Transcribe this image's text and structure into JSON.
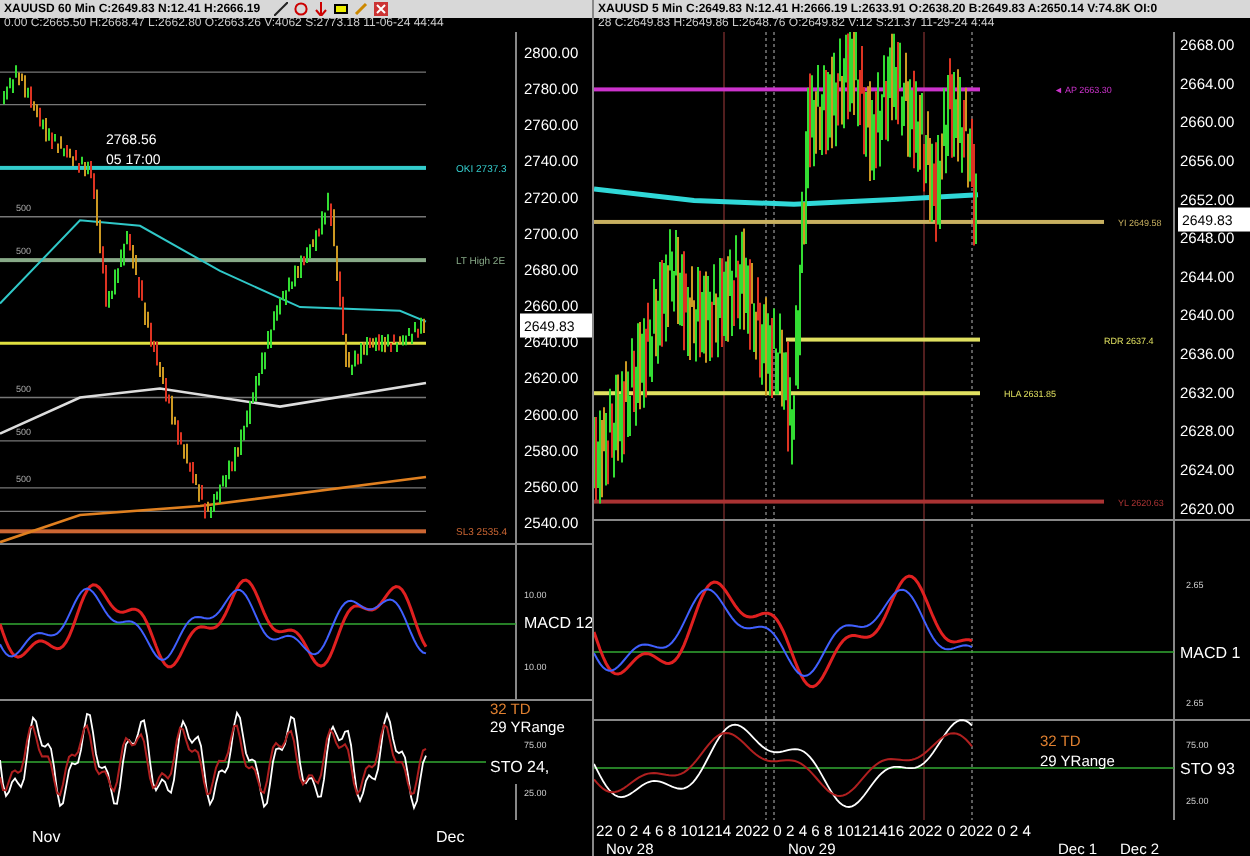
{
  "left_chart": {
    "header": "XAUUSD 60 Min C:2649.83 N:12.41 H:2666.19",
    "info": "0.00 C:2665.50 H:2668.47 L:2662.80 O:2663.26 V:4062 S:2773.18 11-06-24 44:44",
    "price_axis": [
      "2800.00",
      "2780.00",
      "2760.00",
      "2740.00",
      "2720.00",
      "2700.00",
      "2680.00",
      "2660.00",
      "2640.00",
      "2620.00",
      "2600.00",
      "2580.00",
      "2560.00",
      "2540.00"
    ],
    "last_price": "2649.83",
    "annotations": [
      "2768.56",
      "05 17:00"
    ],
    "levels": [
      {
        "label": "OKI 2737.3",
        "color": "#33cccc"
      },
      {
        "label": "LT High 2E",
        "color": "#88aa88"
      },
      {
        "label": "SL3 2535.4",
        "color": "#cc6633"
      }
    ],
    "fib_labels": [
      "500",
      "500",
      "500",
      "500",
      "500"
    ],
    "macd": {
      "label": "MACD 12",
      "scale": [
        "10.00",
        "10.00"
      ]
    },
    "sto": {
      "labels": [
        {
          "text": "32 TD",
          "color": "#e08030"
        },
        {
          "text": "29 YRange",
          "color": "#ffffff"
        }
      ],
      "label": "STO  24,",
      "scale": [
        "75.00",
        "25.00"
      ]
    },
    "time_axis": [
      "Nov",
      "Dec"
    ]
  },
  "right_chart": {
    "header": "XAUUSD 5 Min C:2649.83 N:12.41 H:2666.19 L:2633.91 O:2638.20 B:2649.83 A:2650.14 V:74.8K OI:0",
    "info": "28 C:2649.83 H:2649.86 L:2648.76 O:2649.82 V:12 S:21.37 11-29-24 4:44",
    "price_axis": [
      "2668.00",
      "2664.00",
      "2660.00",
      "2656.00",
      "2652.00",
      "2648.00",
      "2644.00",
      "2640.00",
      "2636.00",
      "2632.00",
      "2628.00",
      "2624.00",
      "2620.00"
    ],
    "last_price": "2649.83",
    "levels": [
      {
        "label": "◄ AP 2663.30",
        "color": "#cc33cc"
      },
      {
        "label": "YI 2649.58",
        "color": "#c8b060"
      },
      {
        "label": "RDR 2637.4",
        "color": "#e0e060"
      },
      {
        "label": "HLA 2631.85",
        "color": "#e0e060"
      },
      {
        "label": "YL 2620.63",
        "color": "#aa3333"
      }
    ],
    "macd": {
      "label": "MACD 1",
      "scale": [
        "2.65",
        "2.65"
      ]
    },
    "sto": {
      "labels": [
        {
          "text": "32 TD",
          "color": "#e08030"
        },
        {
          "text": "29 YRange",
          "color": "#ffffff"
        }
      ],
      "label": "STO  93",
      "scale": [
        "75.00",
        "25.00"
      ]
    },
    "time_axis": {
      "hours": "22 0 2 4 6 8 101214 2022 0 2 4 6 8 10121416 2022 0 2022 0 2 4",
      "dates": [
        "Nov 28",
        "Nov 29",
        "Dec 1",
        "Dec 2"
      ]
    }
  }
}
